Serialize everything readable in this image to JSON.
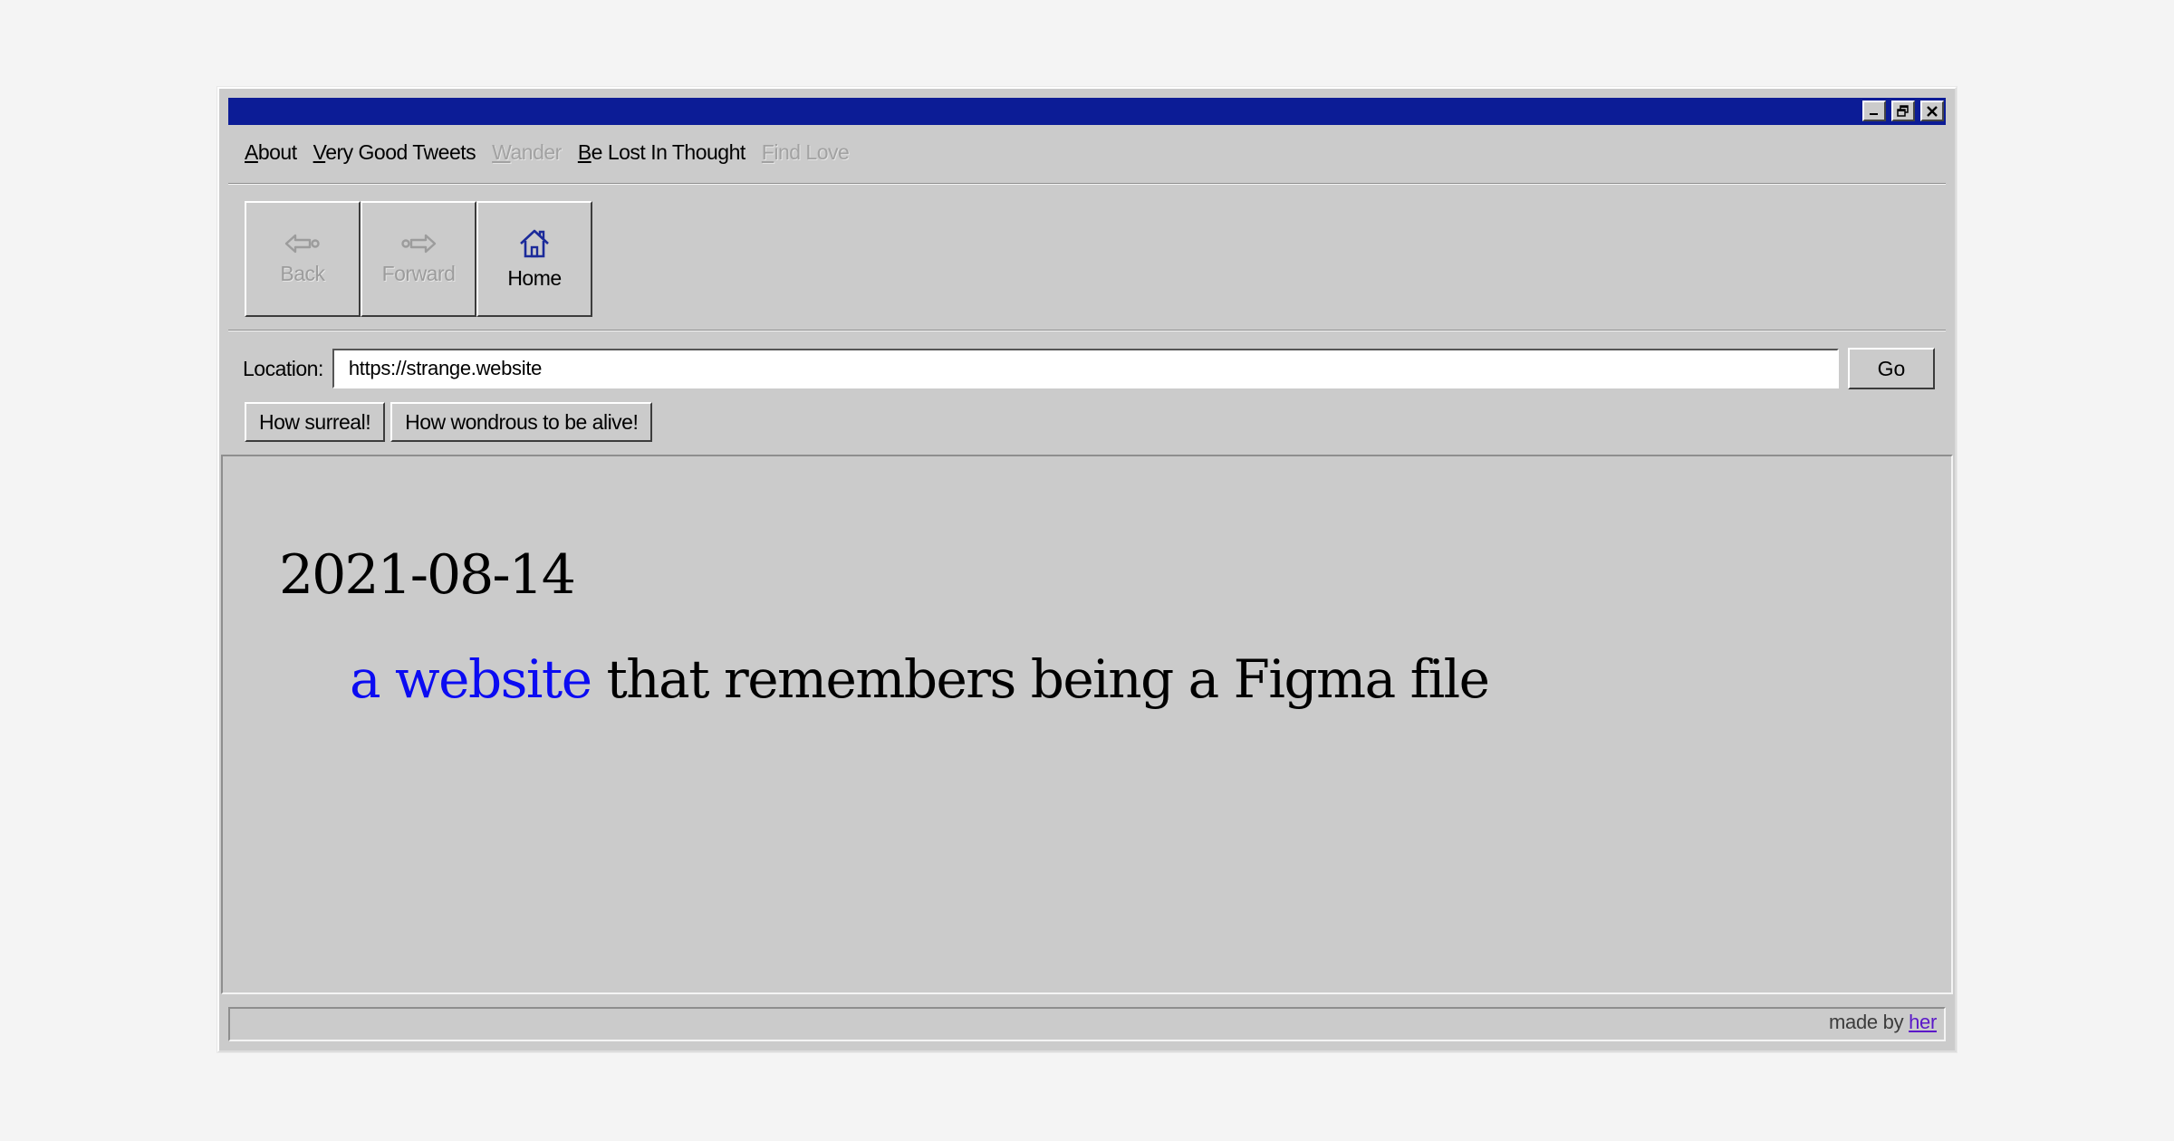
{
  "window": {
    "title": "",
    "controls": [
      "minimize-icon",
      "restore-icon",
      "close-icon"
    ],
    "titlebar_color": "#0c1c96"
  },
  "menu": {
    "items": [
      {
        "accel": "A",
        "rest": "bout",
        "enabled": true
      },
      {
        "accel": "V",
        "rest": "ery Good Tweets",
        "enabled": true
      },
      {
        "accel": "W",
        "rest": "ander",
        "enabled": false
      },
      {
        "accel": "B",
        "rest": "e Lost In Thought",
        "enabled": true
      },
      {
        "accel": "F",
        "rest": "ind Love",
        "enabled": false
      }
    ]
  },
  "toolbar": {
    "back_label": "Back",
    "forward_label": "Forward",
    "home_label": "Home"
  },
  "location": {
    "label": "Location:",
    "value": "https://strange.website",
    "go_label": "Go"
  },
  "links": {
    "surreal": "How surreal!",
    "wondrous": "How wondrous to be alive!"
  },
  "content": {
    "date": "2021-08-14",
    "link_text": "a website",
    "rest_text": " that remembers being a Figma file",
    "link_color": "#0b0bf2"
  },
  "status": {
    "prefix": "made by ",
    "link_text": "her"
  }
}
